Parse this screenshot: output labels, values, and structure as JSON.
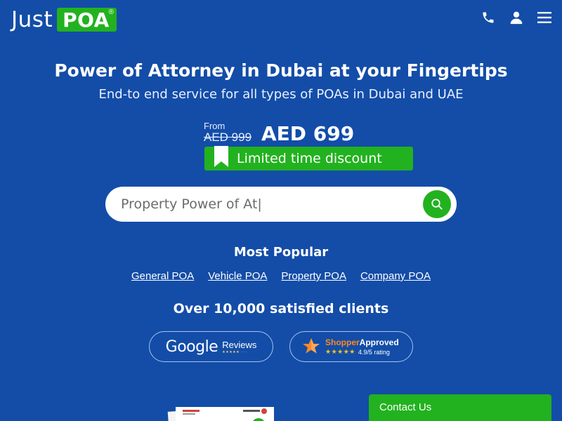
{
  "header": {
    "logo_text": "Just",
    "logo_badge": "POA",
    "logo_reg": "®",
    "icons": [
      "phone-icon",
      "user-icon",
      "menu-icon"
    ]
  },
  "hero": {
    "title": "Power of Attorney in Dubai at your Fingertips",
    "subtitle": "End-to end service for all types of POAs in Dubai and UAE"
  },
  "pricing": {
    "from_label": "From",
    "old_price": "AED 999",
    "new_price": "AED 699",
    "discount_label": "Limited time discount"
  },
  "search": {
    "value": "Property Power of At|",
    "placeholder": ""
  },
  "popular": {
    "title": "Most Popular",
    "links": [
      "General POA",
      "Vehicle POA",
      "Property POA",
      "Company POA"
    ]
  },
  "clients": {
    "title": "Over 10,000 satisfied clients",
    "google": {
      "word": "Google",
      "reviews": "Reviews"
    },
    "shopper": {
      "brand_a": "Shopper",
      "brand_b": "Approved",
      "rating": "4.9/5 rating"
    }
  },
  "contact": {
    "label": "Contact Us"
  },
  "colors": {
    "background": "#134da8",
    "accent": "#22b21f"
  }
}
